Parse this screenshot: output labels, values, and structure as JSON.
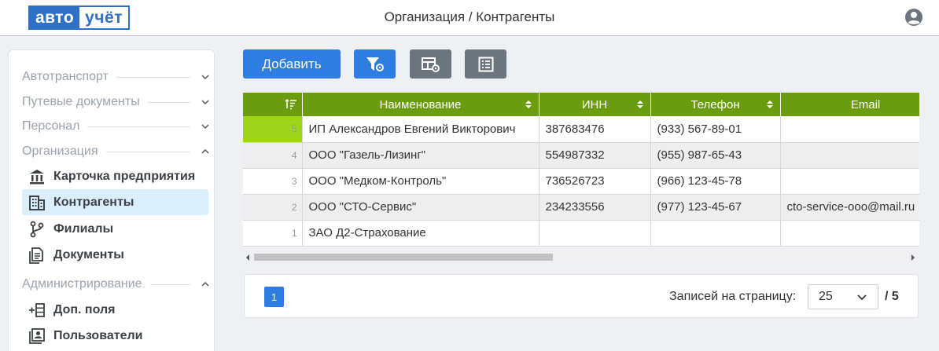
{
  "app": {
    "logo_part1": "авто",
    "logo_part2": "учёт",
    "title": "Организация / Контрагенты"
  },
  "sidebar": {
    "sections": [
      {
        "label": "Автотранспорт",
        "expanded": false
      },
      {
        "label": "Путевые документы",
        "expanded": false
      },
      {
        "label": "Персонал",
        "expanded": false
      },
      {
        "label": "Организация",
        "expanded": true
      },
      {
        "label": "Администрирование",
        "expanded": true
      }
    ],
    "items": [
      {
        "label": "Карточка предприятия",
        "icon": "bank-icon"
      },
      {
        "label": "Контрагенты",
        "icon": "building-icon",
        "active": true
      },
      {
        "label": "Филиалы",
        "icon": "branch-icon"
      },
      {
        "label": "Документы",
        "icon": "documents-icon"
      },
      {
        "label": "Доп. поля",
        "icon": "add-field-icon"
      },
      {
        "label": "Пользователи",
        "icon": "users-icon"
      }
    ]
  },
  "toolbar": {
    "add_label": "Добавить"
  },
  "table": {
    "columns": [
      "",
      "Наименование",
      "ИНН",
      "Телефон",
      "Email"
    ],
    "rows": [
      {
        "num": "5",
        "name": "ИП Александров Евгений Викторович",
        "inn": "387683476",
        "phone": "(933) 567-89-01",
        "email": ""
      },
      {
        "num": "4",
        "name": "ООО \"Газель-Лизинг\"",
        "inn": "554987332",
        "phone": "(955) 987-65-43",
        "email": ""
      },
      {
        "num": "3",
        "name": "ООО \"Медком-Контроль\"",
        "inn": "736526723",
        "phone": "(966) 123-45-78",
        "email": ""
      },
      {
        "num": "2",
        "name": "ООО \"СТО-Сервис\"",
        "inn": "234233556",
        "phone": "(977) 123-45-67",
        "email": "cto-service-ooo@mail.ru"
      },
      {
        "num": "1",
        "name": "ЗАО Д2-Страхование",
        "inn": "",
        "phone": "",
        "email": ""
      }
    ]
  },
  "pagination": {
    "current_page": "1",
    "per_page_label": "Записей на страницу:",
    "per_page_value": "25",
    "total": "/ 5"
  },
  "colors": {
    "accent": "#2f7de1",
    "header_green": "#6b9c10",
    "highlight": "#9ed51b"
  }
}
